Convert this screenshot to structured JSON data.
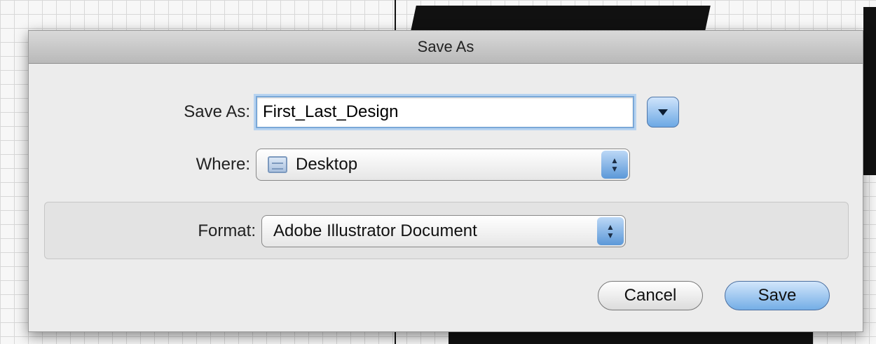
{
  "dialog": {
    "title": "Save As",
    "save_as_label": "Save As:",
    "save_as_value": "First_Last_Design",
    "where_label": "Where:",
    "where_value": "Desktop",
    "format_label": "Format:",
    "format_value": "Adobe Illustrator Document",
    "cancel_label": "Cancel",
    "save_label": "Save"
  },
  "icons": {
    "disclosure": "triangle-down",
    "stepper": "up-down-arrows",
    "folder": "folder"
  }
}
